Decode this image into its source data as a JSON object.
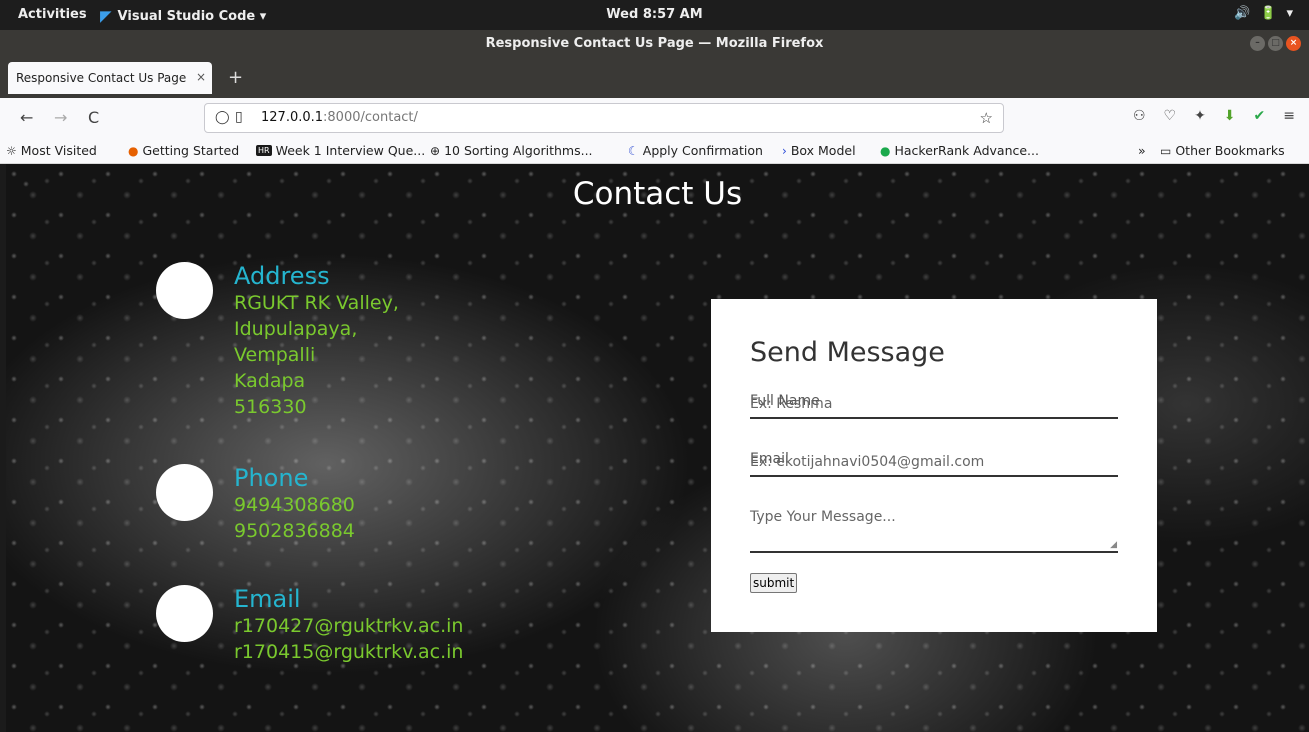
{
  "system": {
    "activities": "Activities",
    "app_name": "Visual Studio Code ▾",
    "clock": "Wed  8:57 AM",
    "tray": [
      "🔊",
      "🔋",
      "▾"
    ]
  },
  "window": {
    "title": "Responsive Contact Us Page — Mozilla Firefox"
  },
  "tab": {
    "label": "Responsive Contact Us Page",
    "close": "×",
    "new_tab": "+"
  },
  "nav": {
    "back": "←",
    "forward": "→",
    "reload": "C",
    "url_host": "127.0.0.1",
    "url_path": ":8000/contact/",
    "star": "☆"
  },
  "bookmarks": [
    {
      "icon": "☼",
      "label": "Most Visited"
    },
    {
      "icon": "●",
      "label": "Getting Started"
    },
    {
      "icon": "HR",
      "label": "Week 1 Interview Que..."
    },
    {
      "icon": "⊕",
      "label": "10 Sorting Algorithms..."
    },
    {
      "icon": "☾",
      "label": "Apply Confirmation"
    },
    {
      "icon": "›",
      "label": "Box Model"
    },
    {
      "icon": "●",
      "label": "HackerRank Advance..."
    }
  ],
  "bookmarks_more": "»",
  "other_bookmarks": "Other Bookmarks",
  "page": {
    "title": "Contact Us",
    "address": {
      "heading": "Address",
      "lines": [
        "RGUKT RK Valley,",
        "Idupulapaya,",
        "Vempalli",
        "Kadapa",
        "516330"
      ]
    },
    "phone": {
      "heading": "Phone",
      "lines": [
        "9494308680",
        "9502836884"
      ]
    },
    "email": {
      "heading": "Email",
      "lines": [
        "r170427@rguktrkv.ac.in",
        "r170415@rguktrkv.ac.in"
      ]
    },
    "form": {
      "title": "Send Message",
      "name_label": "Full Name",
      "name_placeholder": "Ex: Reshma",
      "email_label": "Email",
      "email_placeholder": "Ex: ekotijahnavi0504@gmail.com",
      "message_placeholder": "Type Your Message...",
      "submit": "submit"
    }
  },
  "colors": {
    "heading": "#25b5cf",
    "info_text": "#7ac92e",
    "ubuntu_orange": "#e95420"
  }
}
